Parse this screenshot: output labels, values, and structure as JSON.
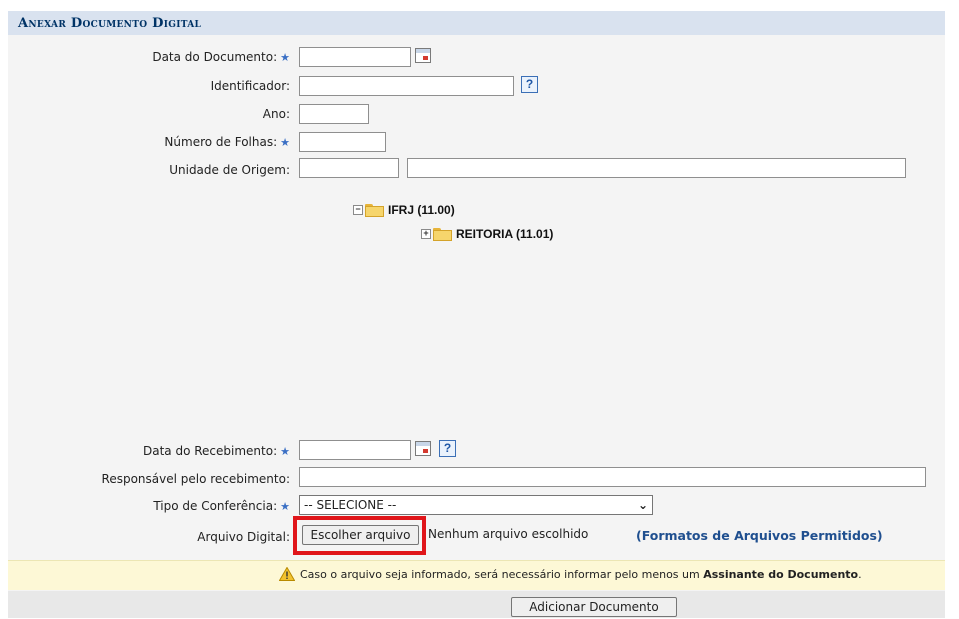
{
  "section": {
    "title": "Anexar Documento Digital"
  },
  "fields": {
    "data_documento": {
      "label": "Data do Documento:",
      "value": ""
    },
    "identificador": {
      "label": "Identificador:",
      "value": ""
    },
    "ano": {
      "label": "Ano:",
      "value": ""
    },
    "numero_folhas": {
      "label": "Número de Folhas:",
      "value": ""
    },
    "unidade_origem": {
      "label": "Unidade de Origem:",
      "code_value": "",
      "name_value": ""
    },
    "data_recebimento": {
      "label": "Data do Recebimento:",
      "value": ""
    },
    "responsavel": {
      "label": "Responsável pelo recebimento:",
      "value": ""
    },
    "tipo_conferencia": {
      "label": "Tipo de Conferência:",
      "selected": "-- SELECIONE --"
    },
    "arquivo_digital": {
      "label": "Arquivo Digital:",
      "button": "Escolher arquivo",
      "status": "Nenhum arquivo escolhido",
      "formats_link": "(Formatos de Arquivos Permitidos)"
    }
  },
  "tree": {
    "root": {
      "label": "IFRJ (11.00)",
      "expander": "−"
    },
    "child": {
      "label": "REITORIA (11.01)",
      "expander": "+"
    }
  },
  "required_marker": "★",
  "help_glyph": "?",
  "warning": {
    "text_prefix": "Caso o arquivo seja informado, será necessário informar pelo menos um ",
    "text_bold": "Assinante do Documento",
    "text_suffix": "."
  },
  "footer": {
    "submit_label": "Adicionar Documento"
  },
  "colors": {
    "title": "#003366",
    "title_bg": "#d9e2ef",
    "highlight": "#e0151a",
    "link": "#1f4f8f",
    "warning_bg": "#fdf8d6"
  }
}
